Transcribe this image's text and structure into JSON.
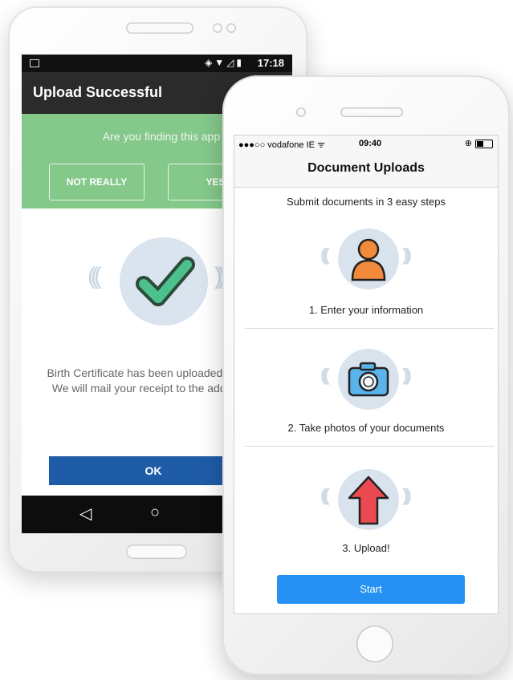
{
  "android": {
    "status": {
      "time": "17:18"
    },
    "appbar_title": "Upload Successful",
    "banner": {
      "question": "Are you finding this app useful?",
      "not_really": "NOT REALLY",
      "yes": "YES"
    },
    "message": "Birth Certificate has been uploaded successfully. We will mail your receipt to the address on file.",
    "ok_label": "OK",
    "nav": {
      "back": "◁",
      "home": "○"
    }
  },
  "iphone": {
    "status": {
      "carrier": "●●●○○ vodafone IE ᯤ",
      "time": "09:40",
      "lock": "⊕"
    },
    "nav_title": "Document Uploads",
    "subtitle": "Submit documents in 3 easy steps",
    "steps": [
      {
        "label": "1. Enter your information",
        "icon": "person-icon"
      },
      {
        "label": "2. Take photos of your documents",
        "icon": "camera-icon"
      },
      {
        "label": "3. Upload!",
        "icon": "upload-arrow-icon"
      }
    ],
    "start_label": "Start"
  },
  "colors": {
    "banner_green": "#84c88a",
    "ok_blue": "#1f5ca8",
    "start_blue": "#2491f3",
    "check_green": "#4cc08d",
    "person_orange": "#f28a3c",
    "arrow_red": "#ea4a4f"
  }
}
